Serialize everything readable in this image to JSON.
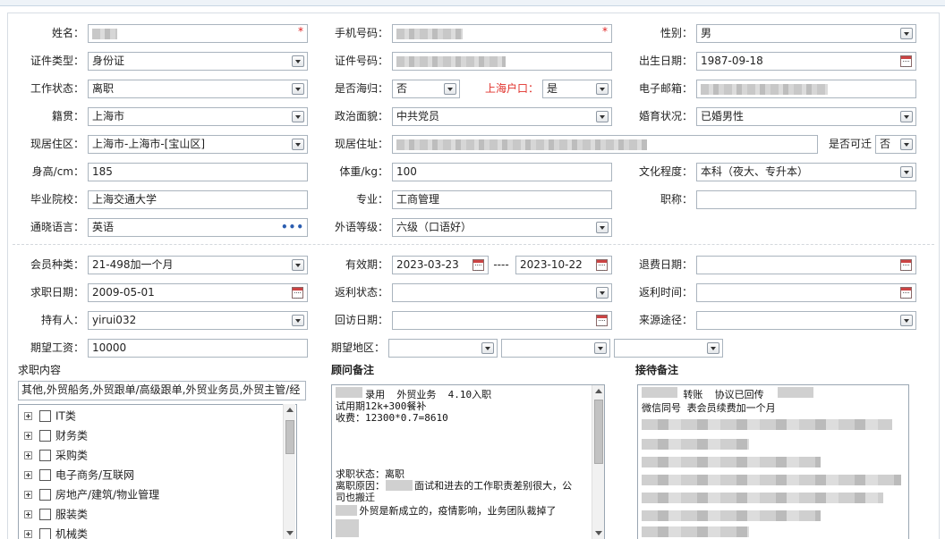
{
  "form": {
    "name": {
      "label": "姓名："
    },
    "mobile": {
      "label": "手机号码："
    },
    "gender": {
      "label": "性别：",
      "value": "男"
    },
    "id_type": {
      "label": "证件类型：",
      "value": "身份证"
    },
    "id_number": {
      "label": "证件号码："
    },
    "birth_date": {
      "label": "出生日期：",
      "value": "1987-09-18"
    },
    "work_status": {
      "label": "工作状态：",
      "value": "离职"
    },
    "returnee": {
      "label": "是否海归：",
      "value": "否"
    },
    "shanghai_hukou": {
      "label": "上海户口：",
      "value": "是"
    },
    "email": {
      "label": "电子邮箱："
    },
    "native_place": {
      "label": "籍贯：",
      "value": "上海市"
    },
    "political": {
      "label": "政治面貌：",
      "value": "中共党员"
    },
    "marital": {
      "label": "婚育状况：",
      "value": "已婚男性"
    },
    "current_area": {
      "label": "现居住区：",
      "value": "上海市-上海市-[宝山区]"
    },
    "current_address": {
      "label": "现居住址："
    },
    "relocatable": {
      "label": "是否可迁",
      "value": "否"
    },
    "height": {
      "label": "身高/cm：",
      "value": "185"
    },
    "weight": {
      "label": "体重/kg：",
      "value": "100"
    },
    "education": {
      "label": "文化程度：",
      "value": "本科（夜大、专升本）"
    },
    "school": {
      "label": "毕业院校：",
      "value": "上海交通大学"
    },
    "major": {
      "label": "专业：",
      "value": "工商管理"
    },
    "title": {
      "label": "职称：",
      "value": ""
    },
    "language": {
      "label": "通晓语言：",
      "value": "英语"
    },
    "language_level": {
      "label": "外语等级：",
      "value": "六级（口语好）"
    },
    "member_type": {
      "label": "会员种类：",
      "value": "21-498加一个月"
    },
    "validity": {
      "label": "有效期：",
      "start": "2023-03-23",
      "sep": "----",
      "end": "2023-10-22"
    },
    "refund_date": {
      "label": "退费日期：",
      "value": ""
    },
    "job_date": {
      "label": "求职日期：",
      "value": "2009-05-01"
    },
    "rebate_status": {
      "label": "返利状态：",
      "value": ""
    },
    "rebate_time": {
      "label": "返利时间：",
      "value": ""
    },
    "holder": {
      "label": "持有人：",
      "value": "yirui032"
    },
    "visit_date": {
      "label": "回访日期：",
      "value": ""
    },
    "source": {
      "label": "来源途径：",
      "value": ""
    },
    "expected_salary": {
      "label": "期望工资：",
      "value": "10000"
    },
    "expected_area": {
      "label": "期望地区：",
      "value": ""
    }
  },
  "job_content": {
    "title": "求职内容",
    "selected": "其他,外贸船务,外贸跟单/高级跟单,外贸业务员,外贸主管/经",
    "tree": [
      "IT类",
      "财务类",
      "采购类",
      "电子商务/互联网",
      "房地产/建筑/物业管理",
      "服装类",
      "机械类"
    ]
  },
  "advisor_notes": {
    "title": "顾问备注",
    "lines": [
      "     录用  外贸业务  4.10入职",
      "试用期12k+300餐补",
      "收费：12300*0.7=8610",
      "",
      "",
      "",
      "求职状态：离职",
      "离职原因：     面试和进去的工作职责差别很大，公",
      "司也搬迁",
      "    外贸是新成立的，疫情影响，业务团队裁掉了"
    ]
  },
  "reception_notes": {
    "title": "接待备注",
    "lines": [
      "       转账  协议已回传",
      "微信同号 表会员续费加一个月"
    ]
  },
  "colors": {
    "required": "#e02020",
    "hukou_label": "#e0302a",
    "border": "#aab4be"
  }
}
